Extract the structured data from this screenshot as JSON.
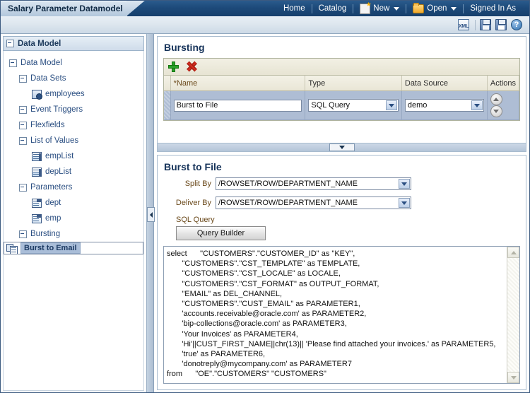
{
  "window": {
    "tab_title": "Salary Parameter Datamodel"
  },
  "topnav": {
    "home": "Home",
    "catalog": "Catalog",
    "new": "New",
    "open": "Open",
    "signed_in_as": "Signed In As"
  },
  "toolbar": {
    "xml_label": "XML",
    "help_label": "?",
    "icons": [
      "xml-sample-icon",
      "save-icon",
      "save-as-icon",
      "help-icon"
    ]
  },
  "sidebar": {
    "header": "Data Model",
    "items": [
      {
        "label": "Data Model",
        "level": 0,
        "icon": "expander",
        "selected": false
      },
      {
        "label": "Data Sets",
        "level": 1,
        "icon": "expander",
        "selected": false
      },
      {
        "label": "employees",
        "level": 2,
        "icon": "dataset-icon",
        "selected": false
      },
      {
        "label": "Event Triggers",
        "level": 1,
        "icon": "expander",
        "selected": false
      },
      {
        "label": "Flexfields",
        "level": 1,
        "icon": "expander",
        "selected": false
      },
      {
        "label": "List of Values",
        "level": 1,
        "icon": "expander",
        "selected": false
      },
      {
        "label": "empList",
        "level": 2,
        "icon": "lov-icon",
        "selected": false
      },
      {
        "label": "depList",
        "level": 2,
        "icon": "lov-icon",
        "selected": false
      },
      {
        "label": "Parameters",
        "level": 1,
        "icon": "expander",
        "selected": false
      },
      {
        "label": "dept",
        "level": 2,
        "icon": "parameter-icon",
        "selected": false
      },
      {
        "label": "emp",
        "level": 2,
        "icon": "parameter-icon",
        "selected": false
      },
      {
        "label": "Bursting",
        "level": 1,
        "icon": "expander",
        "selected": false
      },
      {
        "label": "Burst to Email",
        "level": 3,
        "icon": "bursting-icon",
        "selected": true
      }
    ]
  },
  "bursting_section": {
    "title": "Bursting",
    "add_tooltip": "Add",
    "delete_tooltip": "Delete",
    "columns": [
      "*Name",
      "Type",
      "Data Source",
      "Actions"
    ],
    "rows": [
      {
        "name": "Burst to File",
        "type": "SQL Query",
        "data_source": "demo",
        "actions": [
          "move-up-button",
          "move-down-button"
        ]
      }
    ]
  },
  "detail_section": {
    "title": "Burst to File",
    "split_by_label": "Split By",
    "split_by_value": "/ROWSET/ROW/DEPARTMENT_NAME",
    "deliver_by_label": "Deliver By",
    "deliver_by_value": "/ROWSET/ROW/DEPARTMENT_NAME",
    "sql_query_label": "SQL Query",
    "query_builder_button": "Query Builder",
    "sql_lines": [
      "select      \"CUSTOMERS\".\"CUSTOMER_ID\" as \"KEY\",",
      "       \"CUSTOMERS\".\"CST_TEMPLATE\" as TEMPLATE,",
      "       \"CUSTOMERS\".\"CST_LOCALE\" as LOCALE,",
      "       \"CUSTOMERS\".\"CST_FORMAT\" as OUTPUT_FORMAT,",
      "       \"EMAIL\" as DEL_CHANNEL,",
      "       \"CUSTOMERS\".\"CUST_EMAIL\" as PARAMETER1,",
      "       'accounts.receivable@oracle.com' as PARAMETER2,",
      "       'bip-collections@oracle.com' as PARAMETER3,",
      "       'Your Invoices' as PARAMETER4,",
      "       'Hi'||CUST_FIRST_NAME||chr(13)|| 'Please find attached your invoices.' as PARAMETER5,",
      "       'true' as PARAMETER6,",
      "       'donotreply@mycompany.com' as PARAMETER7",
      "from      \"OE\".\"CUSTOMERS\" \"CUSTOMERS\""
    ]
  },
  "colors": {
    "titlebar_blue": "#1d4a7a",
    "tab_bg": "#c6d6e6",
    "selection_blue": "#a9bdd8",
    "row_blue": "#aebdd4",
    "label_brown": "#6b4a1c",
    "link_blue": "#2b4f82"
  }
}
